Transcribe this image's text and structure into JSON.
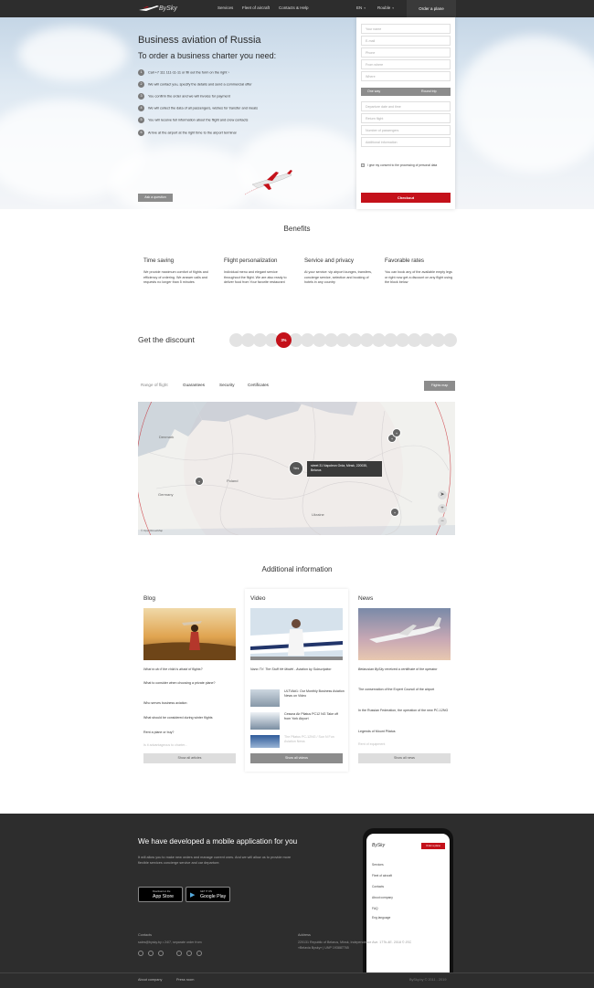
{
  "header": {
    "brand": "BySky",
    "nav": [
      "Services",
      "Fleet of aircraft",
      "Contacts & Help"
    ],
    "language": "EN",
    "currency": "Rouble",
    "order_label": "Order a plane"
  },
  "hero": {
    "title": "Business aviation of Russia",
    "subtitle": "To order a business charter you need:",
    "steps": [
      {
        "n": "1",
        "text": "Call +7 111 111-11-11 or fill out the form on the right ›"
      },
      {
        "n": "2",
        "text": "We will contact you, specify the details and send a commercial offer"
      },
      {
        "n": "3",
        "text": "You confirm the order and we will invoice for payment"
      },
      {
        "n": "4",
        "text": "We will collect the data of all passengers, wishes for transfer and meals"
      },
      {
        "n": "5",
        "text": "You will receive full information about the flight and crew contacts"
      },
      {
        "n": "6",
        "text": "Arrive at the airport at the right time to the airport terminal"
      }
    ],
    "faq_label": "Ask a question"
  },
  "form": {
    "fields": [
      "Your name",
      "E-mail",
      "Phone",
      "From where",
      "Where"
    ],
    "trip_options": [
      "One way",
      "Round trip"
    ],
    "fields2": [
      "Departure date and time",
      "Return flight",
      "Number of passengers",
      "Additional information"
    ],
    "consent": "I give my consent to the processing of personal data",
    "submit": "Checkout"
  },
  "benefits": {
    "title": "Benefits",
    "items": [
      {
        "title": "Time saving",
        "text": "We provide maximum comfort of flights and efficiency of ordering. We answer calls and requests no longer than 5 minutes"
      },
      {
        "title": "Flight personalization",
        "text": "Individual menu and elegant service throughout the flight. We are also ready to deliver food from Your favorite restaurant"
      },
      {
        "title": "Service and privacy",
        "text": "At your service: vip airport lounges, transfers, concierge service, selection and booking of hotels in any country"
      },
      {
        "title": "Favorable rates",
        "text": "You can book any of the available empty legs or right now get a discount on any flight using the block below"
      }
    ]
  },
  "discount": {
    "title": "Get the discount",
    "active_label": "3%",
    "total_circles": 19,
    "active_index": 4
  },
  "tabs": {
    "items": [
      "Range of flight",
      "Guarantees",
      "Security",
      "Certificates"
    ],
    "flights_map": "Flights map"
  },
  "map": {
    "tooltip": "street 31 Napoleon Orda, Minsk, 220035, Belarus",
    "main_marker": "Yes",
    "labels": [
      "Denmark",
      "Germany",
      "Poland",
      "Ukraine"
    ],
    "zoom_in": "+",
    "zoom_out": "−",
    "attribution": "© OpenStreetMap"
  },
  "additional": {
    "title": "Additional information",
    "blog": {
      "title": "Blog",
      "items": [
        "What to do if the child is afraid of flights?",
        "What to consider when choosing a private plane?",
        "Who serves business aviation",
        "What should be considered during winter flights",
        "Rent a plane or buy?",
        "Is it advantageous to charter..."
      ],
      "button": "Show all articles"
    },
    "video": {
      "title": "Video",
      "caption": "Nano TV: The Stuff He Model - Aviation by Subscription",
      "items": [
        "ULTVA#1: Our Monthly Business Aviation News on Video",
        "Cessna Air Pilatus PC12 NG Take off from York Airport",
        "The Pilatus PC-12NG / Sun N Fun Aviation News"
      ],
      "button": "Show all videos"
    },
    "news": {
      "title": "News",
      "items": [
        "Belarusian BySky received a certificate of the operator",
        "The conservation of the Expert Council of the airport",
        "In the Russian Federation, the operation of the new PC-12NG",
        "Legends of Mount Pilatus",
        "Rent of equipment"
      ],
      "button": "Show all news"
    }
  },
  "footer": {
    "app_title": "We have developed a mobile application for you",
    "app_desc": "It will allow you to make new orders and manage current ones. And we will allow us to provide more flexible services concierge service and car departure.",
    "appstore_small": "Download on the",
    "appstore_big": "App Store",
    "gplay_small": "GET IT ON",
    "gplay_big": "Google Play",
    "contacts_label": "Contacts",
    "contacts_value": "sales@bysky.by • 24/7, separate order from",
    "address_label": "Address",
    "address_value": "220131 Republic of Belarus, Minsk, Independence Ave. 177b-4E. 2018 © JSC «Belavia Bysky» | UNP 193887765",
    "links": [
      "About company",
      "Press room"
    ],
    "copyright": "BySky.by © 2011 - 2019"
  },
  "phone": {
    "order_btn": "Order a plane",
    "menu": [
      "Services",
      "Fleet of aircraft",
      "Contacts",
      "About company",
      "FAQ",
      "Eng language"
    ]
  },
  "colors": {
    "accent": "#c4111a",
    "dark": "#2d2d2d",
    "gray": "#8c8c8c"
  }
}
